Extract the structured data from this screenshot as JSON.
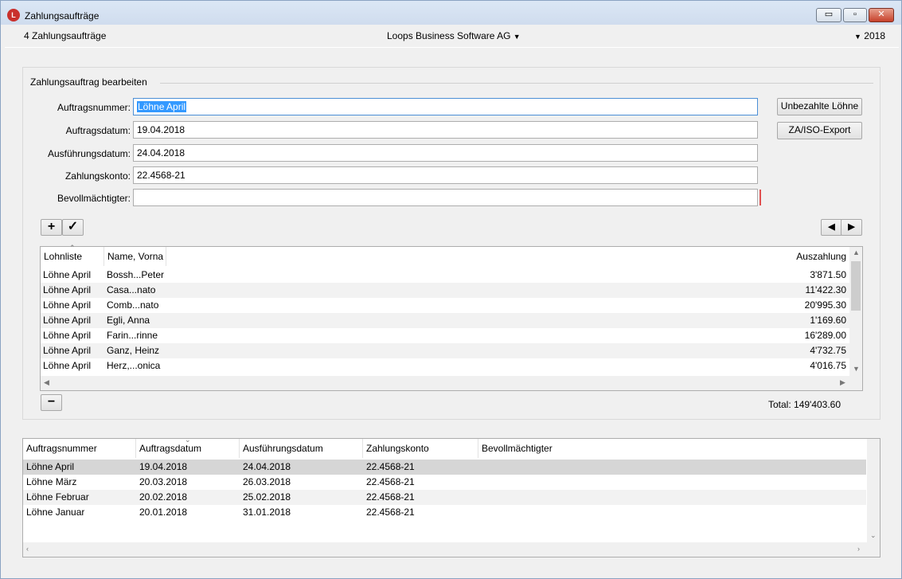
{
  "window": {
    "title": "Zahlungsaufträge",
    "app_icon": "loops-app-icon",
    "controls": {
      "minimize": "▭",
      "maximize": "▫",
      "close": "✕"
    }
  },
  "toolbar": {
    "count_text": "4 Zahlungsaufträge",
    "company": "Loops Business Software AG",
    "company_arrow": "▼",
    "year_arrow": "▼",
    "year": "2018"
  },
  "edit_group": {
    "title": "Zahlungsauftrag bearbeiten",
    "fields": {
      "auftragsnummer": {
        "label": "Auftragsnummer:",
        "value": "Löhne April"
      },
      "auftragsdatum": {
        "label": "Auftragsdatum:",
        "value": "19.04.2018"
      },
      "ausfuehrungsdatum": {
        "label": "Ausführungsdatum:",
        "value": "24.04.2018"
      },
      "zahlungskonto": {
        "label": "Zahlungskonto:",
        "value": "22.4568-21"
      },
      "bevollmaechtigter": {
        "label": "Bevollmächtigter:",
        "value": ""
      }
    },
    "buttons": {
      "unbezahlte": "Unbezahlte Löhne",
      "export": "ZA/ISO-Export",
      "add": "+",
      "confirm": "✓",
      "prev": "◀",
      "next": "▶",
      "remove": "−"
    },
    "payroll_table": {
      "headers": {
        "lohnliste": "Lohnliste",
        "name": "Name, Vorna",
        "auszahlung": "Auszahlung"
      },
      "rows": [
        {
          "lohnliste": "Löhne April",
          "name": "Bossh...Peter",
          "auszahlung": "3'871.50"
        },
        {
          "lohnliste": "Löhne April",
          "name": "Casa...nato",
          "auszahlung": "11'422.30"
        },
        {
          "lohnliste": "Löhne April",
          "name": "Comb...nato",
          "auszahlung": "20'995.30"
        },
        {
          "lohnliste": "Löhne April",
          "name": "Egli, Anna",
          "auszahlung": "1'169.60"
        },
        {
          "lohnliste": "Löhne April",
          "name": "Farin...rinne",
          "auszahlung": "16'289.00"
        },
        {
          "lohnliste": "Löhne April",
          "name": "Ganz, Heinz",
          "auszahlung": "4'732.75"
        },
        {
          "lohnliste": "Löhne April",
          "name": "Herz,...onica",
          "auszahlung": "4'016.75"
        }
      ]
    },
    "total": "Total: 149'403.60"
  },
  "orders_table": {
    "headers": {
      "auftragsnummer": "Auftragsnummer",
      "auftragsdatum": "Auftragsdatum",
      "ausfuehrungsdatum": "Ausführungsdatum",
      "zahlungskonto": "Zahlungskonto",
      "bevollmaechtigter": "Bevollmächtigter"
    },
    "rows": [
      {
        "auftragsnummer": "Löhne April",
        "auftragsdatum": "19.04.2018",
        "ausfuehrungsdatum": "24.04.2018",
        "zahlungskonto": "22.4568-21",
        "bevollmaechtigter": ""
      },
      {
        "auftragsnummer": "Löhne März",
        "auftragsdatum": "20.03.2018",
        "ausfuehrungsdatum": "26.03.2018",
        "zahlungskonto": "22.4568-21",
        "bevollmaechtigter": ""
      },
      {
        "auftragsnummer": "Löhne Februar",
        "auftragsdatum": "20.02.2018",
        "ausfuehrungsdatum": "25.02.2018",
        "zahlungskonto": "22.4568-21",
        "bevollmaechtigter": ""
      },
      {
        "auftragsnummer": "Löhne Januar",
        "auftragsdatum": "20.01.2018",
        "ausfuehrungsdatum": "31.01.2018",
        "zahlungskonto": "22.4568-21",
        "bevollmaechtigter": ""
      }
    ]
  },
  "colors": {
    "selection": "#3399ff",
    "focus_border": "#4b8fd6",
    "selected_row": "#d6d6d6",
    "required_marker": "#e05050"
  }
}
